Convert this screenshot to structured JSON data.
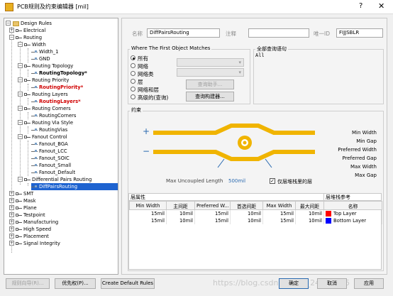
{
  "window": {
    "title": "PCB规则及约束编辑器 [mil]",
    "help": "?",
    "close": "✕"
  },
  "tree": {
    "root": "Design Rules",
    "items": [
      "Electrical",
      "Routing",
      "Width",
      "Width_1",
      "GND",
      "Routing Topology",
      "RoutingTopology*",
      "Routing Priority",
      "RoutingPriority*",
      "Routing Layers",
      "RoutingLayers*",
      "Routing Corners",
      "RoutingCorners",
      "Routing Via Style",
      "RoutingVias",
      "Fanout Control",
      "Fanout_BGA",
      "Fanout_LCC",
      "Fanout_SOIC",
      "Fanout_Small",
      "Fanout_Default",
      "Differential Pairs Routing",
      "DiffPairsRouting",
      "SMT",
      "Mask",
      "Plane",
      "Testpoint",
      "Manufacturing",
      "High Speed",
      "Placement",
      "Signal Integrity"
    ]
  },
  "rule": {
    "name_label": "名称",
    "name_value": "DiffPairsRouting",
    "comment_label": "注释",
    "comment_value": "",
    "id_label": "唯一ID",
    "id_value": "FIJJSBLR"
  },
  "match": {
    "title": "Where The First Object Matches",
    "options": [
      "所有",
      "网络",
      "网络类",
      "层",
      "网络和层",
      "高级的(查询)"
    ],
    "selected": "所有",
    "query_helper": "查询助手...",
    "query_builder": "查询构建器..."
  },
  "full_query": {
    "title": "全部查询语句",
    "text": "All"
  },
  "constraints": {
    "title": "约束",
    "plus": "+",
    "minus": "−",
    "right_labels": [
      "Min Width",
      "Min Gap",
      "Preferred Width",
      "Preferred Gap",
      "Max Width",
      "Max Gap"
    ],
    "uncoupled_label": "Max Uncoupled Length",
    "uncoupled_value": "500mil",
    "layer_stack_only": "仅层堆栈里的层",
    "layer_stack_checked": true
  },
  "layer_table": {
    "left_title": "层属性",
    "right_title": "层堆栈参考",
    "headers": [
      "Min Width",
      "主间距",
      "Preferred W...",
      "首选间距",
      "Max Width",
      "最大间距",
      "名称"
    ],
    "rows": [
      {
        "cells": [
          "15mil",
          "10mil",
          "15mil",
          "10mil",
          "15mil",
          "10mil"
        ],
        "name": "Top Layer",
        "color": "#ff0000"
      },
      {
        "cells": [
          "15mil",
          "10mil",
          "15mil",
          "10mil",
          "15mil",
          "10mil"
        ],
        "name": "Bottom Layer",
        "color": "#0000ff"
      }
    ]
  },
  "buttons": {
    "rule_wizard": "规则向导(R)...",
    "priorities": "优先权(P)...",
    "create_default": "Create Default Rules",
    "ok": "确定",
    "cancel": "取消",
    "apply": "应用"
  },
  "watermark": "https://blog.csdn.net/qq_24312945",
  "colors": {
    "trace": "#f0b400",
    "accent": "#1e63d0",
    "arrow": "#2a6ab0"
  }
}
